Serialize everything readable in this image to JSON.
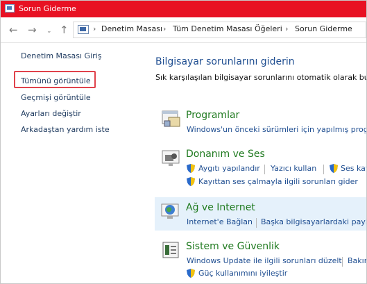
{
  "window": {
    "title": "Sorun Giderme"
  },
  "breadcrumb": {
    "items": [
      "Denetim Masası",
      "Tüm Denetim Masası Öğeleri",
      "Sorun Giderme"
    ]
  },
  "sidebar": {
    "items": [
      {
        "label": "Denetim Masası Giriş"
      },
      {
        "label": "Tümünü görüntüle"
      },
      {
        "label": "Geçmişi görüntüle"
      },
      {
        "label": "Ayarları değiştir"
      },
      {
        "label": "Arkadaştan yardım iste"
      }
    ]
  },
  "main": {
    "title": "Bilgisayar sorunlarını giderin",
    "subtitle": "Sık karşılaşılan bilgisayar sorunlarını otomatik olarak bulm",
    "categories": [
      {
        "title": "Programlar",
        "links": [
          "Windows'un önceki sürümleri için yapılmış progra"
        ]
      },
      {
        "title": "Donanım ve Ses",
        "links": [
          "Aygıtı yapılandır",
          "Yazıcı kullan",
          "Ses kay",
          "Kayıttan ses çalmayla ilgili sorunları gider"
        ]
      },
      {
        "title": "Ağ ve Internet",
        "links": [
          "Internet'e Bağlan",
          "Başka bilgisayarlardaki paylaş"
        ]
      },
      {
        "title": "Sistem ve Güvenlik",
        "links": [
          "Windows Update ile ilgili sorunları düzelt",
          "Bakım",
          "Güç kullanımını iyileştir"
        ]
      }
    ]
  },
  "colors": {
    "titlebar": "#e81123",
    "link": "#1f4e91",
    "category_title": "#1f7a1f",
    "highlight_box": "#e0424b",
    "hover_row": "#e5f1fb"
  }
}
